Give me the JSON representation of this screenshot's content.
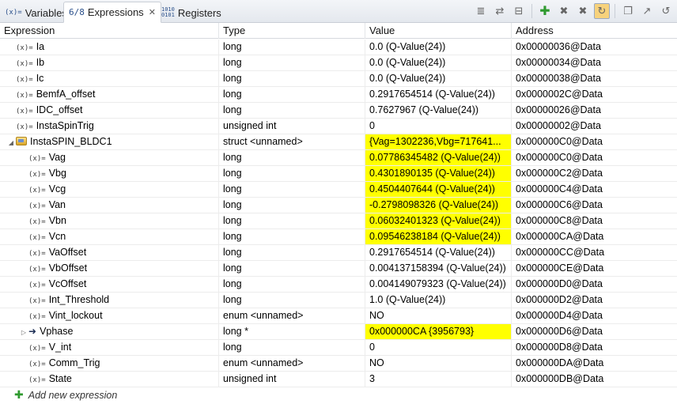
{
  "tabs": [
    {
      "label": "Variables",
      "icon": "(x)="
    },
    {
      "label": "Expressions",
      "icon": "6/8",
      "close": "✕"
    },
    {
      "label": "Registers",
      "icon": "1010\n0101"
    }
  ],
  "toolbar": [
    {
      "name": "show-type-names-icon",
      "glyph": "≣"
    },
    {
      "name": "select-all-icon",
      "glyph": "⇄"
    },
    {
      "name": "collapse-all-icon",
      "glyph": "⊟"
    },
    {
      "name": "add-expression-icon",
      "glyph": "✚"
    },
    {
      "name": "remove-icon",
      "glyph": "✖"
    },
    {
      "name": "remove-all-icon",
      "glyph": "✖"
    },
    {
      "name": "continuous-refresh-icon",
      "glyph": "↻"
    },
    {
      "name": "new-window-icon",
      "glyph": "❐"
    },
    {
      "name": "export-icon",
      "glyph": "↗"
    },
    {
      "name": "refresh-icon",
      "glyph": "↺"
    }
  ],
  "columns": [
    "Expression",
    "Type",
    "Value",
    "Address"
  ],
  "rows": [
    {
      "level": 0,
      "icon": "var",
      "twisty": "",
      "name": "Ia",
      "type": "long",
      "value": "0.0 (Q-Value(24))",
      "address": "0x00000036@Data",
      "hl": false
    },
    {
      "level": 0,
      "icon": "var",
      "twisty": "",
      "name": "Ib",
      "type": "long",
      "value": "0.0 (Q-Value(24))",
      "address": "0x00000034@Data",
      "hl": false
    },
    {
      "level": 0,
      "icon": "var",
      "twisty": "",
      "name": "Ic",
      "type": "long",
      "value": "0.0 (Q-Value(24))",
      "address": "0x00000038@Data",
      "hl": false
    },
    {
      "level": 0,
      "icon": "var",
      "twisty": "",
      "name": "BemfA_offset",
      "type": "long",
      "value": "0.2917654514 (Q-Value(24))",
      "address": "0x0000002C@Data",
      "hl": false
    },
    {
      "level": 0,
      "icon": "var",
      "twisty": "",
      "name": "IDC_offset",
      "type": "long",
      "value": "0.7627967 (Q-Value(24))",
      "address": "0x00000026@Data",
      "hl": false
    },
    {
      "level": 0,
      "icon": "var",
      "twisty": "",
      "name": "InstaSpinTrig",
      "type": "unsigned int",
      "value": "0",
      "address": "0x00000002@Data",
      "hl": false
    },
    {
      "level": 0,
      "icon": "struct",
      "twisty": "◢",
      "name": "InstaSPIN_BLDC1",
      "type": "struct <unnamed>",
      "value": "{Vag=1302236,Vbg=717641...",
      "address": "0x000000C0@Data",
      "hl": true
    },
    {
      "level": 1,
      "icon": "var",
      "twisty": "",
      "name": "Vag",
      "type": "long",
      "value": "0.07786345482 (Q-Value(24))",
      "address": "0x000000C0@Data",
      "hl": true
    },
    {
      "level": 1,
      "icon": "var",
      "twisty": "",
      "name": "Vbg",
      "type": "long",
      "value": "0.4301890135 (Q-Value(24))",
      "address": "0x000000C2@Data",
      "hl": true
    },
    {
      "level": 1,
      "icon": "var",
      "twisty": "",
      "name": "Vcg",
      "type": "long",
      "value": "0.4504407644 (Q-Value(24))",
      "address": "0x000000C4@Data",
      "hl": true
    },
    {
      "level": 1,
      "icon": "var",
      "twisty": "",
      "name": "Van",
      "type": "long",
      "value": "-0.2798098326 (Q-Value(24))",
      "address": "0x000000C6@Data",
      "hl": true
    },
    {
      "level": 1,
      "icon": "var",
      "twisty": "",
      "name": "Vbn",
      "type": "long",
      "value": "0.06032401323 (Q-Value(24))",
      "address": "0x000000C8@Data",
      "hl": true
    },
    {
      "level": 1,
      "icon": "var",
      "twisty": "",
      "name": "Vcn",
      "type": "long",
      "value": "0.09546238184 (Q-Value(24))",
      "address": "0x000000CA@Data",
      "hl": true
    },
    {
      "level": 1,
      "icon": "var",
      "twisty": "",
      "name": "VaOffset",
      "type": "long",
      "value": "0.2917654514 (Q-Value(24))",
      "address": "0x000000CC@Data",
      "hl": false
    },
    {
      "level": 1,
      "icon": "var",
      "twisty": "",
      "name": "VbOffset",
      "type": "long",
      "value": "0.004137158394 (Q-Value(24))",
      "address": "0x000000CE@Data",
      "hl": false
    },
    {
      "level": 1,
      "icon": "var",
      "twisty": "",
      "name": "VcOffset",
      "type": "long",
      "value": "0.004149079323 (Q-Value(24))",
      "address": "0x000000D0@Data",
      "hl": false
    },
    {
      "level": 1,
      "icon": "var",
      "twisty": "",
      "name": "Int_Threshold",
      "type": "long",
      "value": "1.0 (Q-Value(24))",
      "address": "0x000000D2@Data",
      "hl": false
    },
    {
      "level": 1,
      "icon": "var",
      "twisty": "",
      "name": "Vint_lockout",
      "type": "enum <unnamed>",
      "value": "NO",
      "address": "0x000000D4@Data",
      "hl": false
    },
    {
      "level": 1,
      "icon": "pointer",
      "twisty": "▷",
      "name": "Vphase",
      "type": "long *",
      "value": "0x000000CA {3956793}",
      "address": "0x000000D6@Data",
      "hl": true
    },
    {
      "level": 1,
      "icon": "var",
      "twisty": "",
      "name": "V_int",
      "type": "long",
      "value": "0",
      "address": "0x000000D8@Data",
      "hl": false
    },
    {
      "level": 1,
      "icon": "var",
      "twisty": "",
      "name": "Comm_Trig",
      "type": "enum <unnamed>",
      "value": "NO",
      "address": "0x000000DA@Data",
      "hl": false
    },
    {
      "level": 1,
      "icon": "var",
      "twisty": "",
      "name": "State",
      "type": "unsigned int",
      "value": "3",
      "address": "0x000000DB@Data",
      "hl": false
    }
  ],
  "add_expression": "Add new expression",
  "colors": {
    "highlight": "#ffff00",
    "add": "#2f9a2f"
  }
}
